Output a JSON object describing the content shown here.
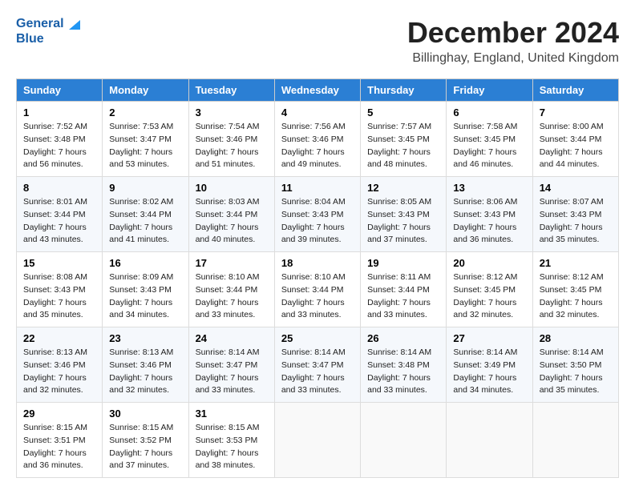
{
  "header": {
    "logo_line1": "General",
    "logo_line2": "Blue",
    "title": "December 2024",
    "subtitle": "Billinghay, England, United Kingdom"
  },
  "weekdays": [
    "Sunday",
    "Monday",
    "Tuesday",
    "Wednesday",
    "Thursday",
    "Friday",
    "Saturday"
  ],
  "weeks": [
    [
      {
        "day": "1",
        "sunrise": "Sunrise: 7:52 AM",
        "sunset": "Sunset: 3:48 PM",
        "daylight": "Daylight: 7 hours and 56 minutes."
      },
      {
        "day": "2",
        "sunrise": "Sunrise: 7:53 AM",
        "sunset": "Sunset: 3:47 PM",
        "daylight": "Daylight: 7 hours and 53 minutes."
      },
      {
        "day": "3",
        "sunrise": "Sunrise: 7:54 AM",
        "sunset": "Sunset: 3:46 PM",
        "daylight": "Daylight: 7 hours and 51 minutes."
      },
      {
        "day": "4",
        "sunrise": "Sunrise: 7:56 AM",
        "sunset": "Sunset: 3:46 PM",
        "daylight": "Daylight: 7 hours and 49 minutes."
      },
      {
        "day": "5",
        "sunrise": "Sunrise: 7:57 AM",
        "sunset": "Sunset: 3:45 PM",
        "daylight": "Daylight: 7 hours and 48 minutes."
      },
      {
        "day": "6",
        "sunrise": "Sunrise: 7:58 AM",
        "sunset": "Sunset: 3:45 PM",
        "daylight": "Daylight: 7 hours and 46 minutes."
      },
      {
        "day": "7",
        "sunrise": "Sunrise: 8:00 AM",
        "sunset": "Sunset: 3:44 PM",
        "daylight": "Daylight: 7 hours and 44 minutes."
      }
    ],
    [
      {
        "day": "8",
        "sunrise": "Sunrise: 8:01 AM",
        "sunset": "Sunset: 3:44 PM",
        "daylight": "Daylight: 7 hours and 43 minutes."
      },
      {
        "day": "9",
        "sunrise": "Sunrise: 8:02 AM",
        "sunset": "Sunset: 3:44 PM",
        "daylight": "Daylight: 7 hours and 41 minutes."
      },
      {
        "day": "10",
        "sunrise": "Sunrise: 8:03 AM",
        "sunset": "Sunset: 3:44 PM",
        "daylight": "Daylight: 7 hours and 40 minutes."
      },
      {
        "day": "11",
        "sunrise": "Sunrise: 8:04 AM",
        "sunset": "Sunset: 3:43 PM",
        "daylight": "Daylight: 7 hours and 39 minutes."
      },
      {
        "day": "12",
        "sunrise": "Sunrise: 8:05 AM",
        "sunset": "Sunset: 3:43 PM",
        "daylight": "Daylight: 7 hours and 37 minutes."
      },
      {
        "day": "13",
        "sunrise": "Sunrise: 8:06 AM",
        "sunset": "Sunset: 3:43 PM",
        "daylight": "Daylight: 7 hours and 36 minutes."
      },
      {
        "day": "14",
        "sunrise": "Sunrise: 8:07 AM",
        "sunset": "Sunset: 3:43 PM",
        "daylight": "Daylight: 7 hours and 35 minutes."
      }
    ],
    [
      {
        "day": "15",
        "sunrise": "Sunrise: 8:08 AM",
        "sunset": "Sunset: 3:43 PM",
        "daylight": "Daylight: 7 hours and 35 minutes."
      },
      {
        "day": "16",
        "sunrise": "Sunrise: 8:09 AM",
        "sunset": "Sunset: 3:43 PM",
        "daylight": "Daylight: 7 hours and 34 minutes."
      },
      {
        "day": "17",
        "sunrise": "Sunrise: 8:10 AM",
        "sunset": "Sunset: 3:44 PM",
        "daylight": "Daylight: 7 hours and 33 minutes."
      },
      {
        "day": "18",
        "sunrise": "Sunrise: 8:10 AM",
        "sunset": "Sunset: 3:44 PM",
        "daylight": "Daylight: 7 hours and 33 minutes."
      },
      {
        "day": "19",
        "sunrise": "Sunrise: 8:11 AM",
        "sunset": "Sunset: 3:44 PM",
        "daylight": "Daylight: 7 hours and 33 minutes."
      },
      {
        "day": "20",
        "sunrise": "Sunrise: 8:12 AM",
        "sunset": "Sunset: 3:45 PM",
        "daylight": "Daylight: 7 hours and 32 minutes."
      },
      {
        "day": "21",
        "sunrise": "Sunrise: 8:12 AM",
        "sunset": "Sunset: 3:45 PM",
        "daylight": "Daylight: 7 hours and 32 minutes."
      }
    ],
    [
      {
        "day": "22",
        "sunrise": "Sunrise: 8:13 AM",
        "sunset": "Sunset: 3:46 PM",
        "daylight": "Daylight: 7 hours and 32 minutes."
      },
      {
        "day": "23",
        "sunrise": "Sunrise: 8:13 AM",
        "sunset": "Sunset: 3:46 PM",
        "daylight": "Daylight: 7 hours and 32 minutes."
      },
      {
        "day": "24",
        "sunrise": "Sunrise: 8:14 AM",
        "sunset": "Sunset: 3:47 PM",
        "daylight": "Daylight: 7 hours and 33 minutes."
      },
      {
        "day": "25",
        "sunrise": "Sunrise: 8:14 AM",
        "sunset": "Sunset: 3:47 PM",
        "daylight": "Daylight: 7 hours and 33 minutes."
      },
      {
        "day": "26",
        "sunrise": "Sunrise: 8:14 AM",
        "sunset": "Sunset: 3:48 PM",
        "daylight": "Daylight: 7 hours and 33 minutes."
      },
      {
        "day": "27",
        "sunrise": "Sunrise: 8:14 AM",
        "sunset": "Sunset: 3:49 PM",
        "daylight": "Daylight: 7 hours and 34 minutes."
      },
      {
        "day": "28",
        "sunrise": "Sunrise: 8:14 AM",
        "sunset": "Sunset: 3:50 PM",
        "daylight": "Daylight: 7 hours and 35 minutes."
      }
    ],
    [
      {
        "day": "29",
        "sunrise": "Sunrise: 8:15 AM",
        "sunset": "Sunset: 3:51 PM",
        "daylight": "Daylight: 7 hours and 36 minutes."
      },
      {
        "day": "30",
        "sunrise": "Sunrise: 8:15 AM",
        "sunset": "Sunset: 3:52 PM",
        "daylight": "Daylight: 7 hours and 37 minutes."
      },
      {
        "day": "31",
        "sunrise": "Sunrise: 8:15 AM",
        "sunset": "Sunset: 3:53 PM",
        "daylight": "Daylight: 7 hours and 38 minutes."
      },
      null,
      null,
      null,
      null
    ]
  ]
}
